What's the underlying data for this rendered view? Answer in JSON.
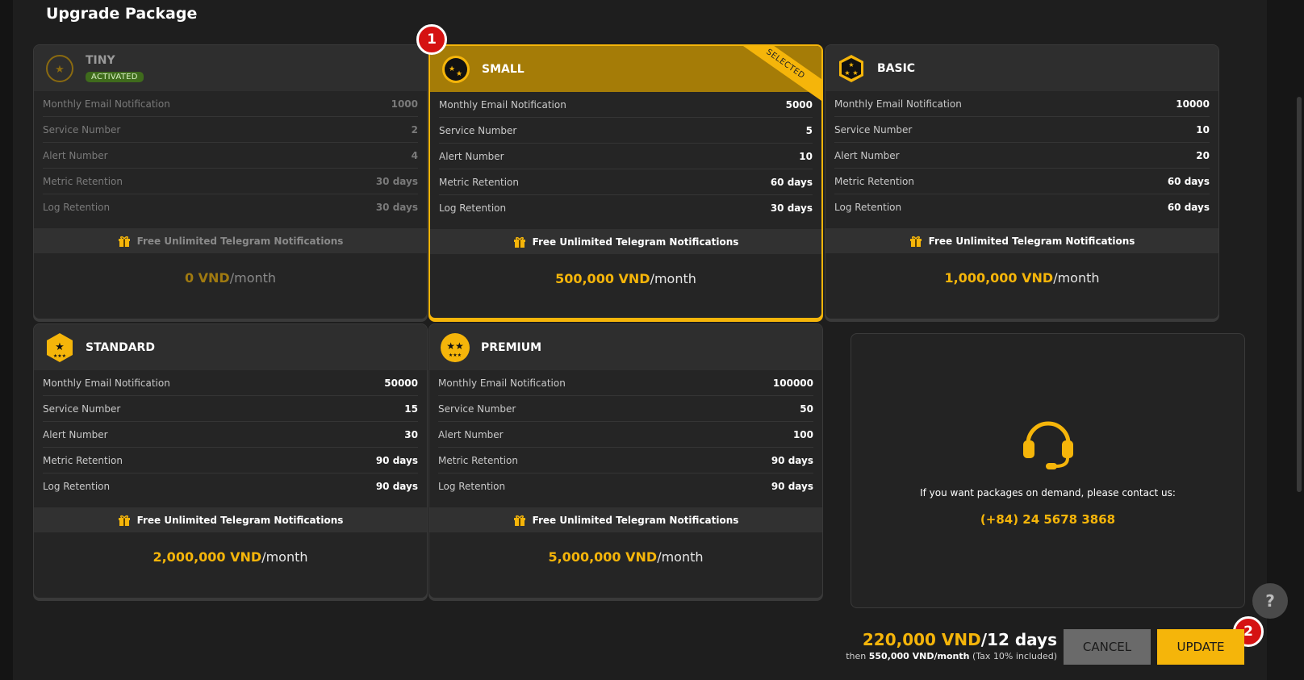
{
  "page": {
    "title": "Upgrade Package"
  },
  "colors": {
    "accent": "#f5b50a",
    "activated_bg": "#3f6b1c",
    "badge": "#d51212"
  },
  "plans": [
    {
      "name": "TINY",
      "status": "ACTIVATED",
      "rows": [
        [
          "Monthly Email Notification",
          "1000"
        ],
        [
          "Service Number",
          "2"
        ],
        [
          "Alert Number",
          "4"
        ],
        [
          "Metric Retention",
          "30 days"
        ],
        [
          "Log Retention",
          "30 days"
        ]
      ],
      "telegram": "Free Unlimited Telegram Notifications",
      "price": "0 VND",
      "per": "/month"
    },
    {
      "name": "SMALL",
      "ribbon": "SELECTED",
      "rows": [
        [
          "Monthly Email Notification",
          "5000"
        ],
        [
          "Service Number",
          "5"
        ],
        [
          "Alert Number",
          "10"
        ],
        [
          "Metric Retention",
          "60 days"
        ],
        [
          "Log Retention",
          "30 days"
        ]
      ],
      "telegram": "Free Unlimited Telegram Notifications",
      "price": "500,000 VND",
      "per": "/month"
    },
    {
      "name": "BASIC",
      "rows": [
        [
          "Monthly Email Notification",
          "10000"
        ],
        [
          "Service Number",
          "10"
        ],
        [
          "Alert Number",
          "20"
        ],
        [
          "Metric Retention",
          "60 days"
        ],
        [
          "Log Retention",
          "60 days"
        ]
      ],
      "telegram": "Free Unlimited Telegram Notifications",
      "price": "1,000,000 VND",
      "per": "/month"
    },
    {
      "name": "STANDARD",
      "rows": [
        [
          "Monthly Email Notification",
          "50000"
        ],
        [
          "Service Number",
          "15"
        ],
        [
          "Alert Number",
          "30"
        ],
        [
          "Metric Retention",
          "90 days"
        ],
        [
          "Log Retention",
          "90 days"
        ]
      ],
      "telegram": "Free Unlimited Telegram Notifications",
      "price": "2,000,000 VND",
      "per": "/month"
    },
    {
      "name": "PREMIUM",
      "rows": [
        [
          "Monthly Email Notification",
          "100000"
        ],
        [
          "Service Number",
          "50"
        ],
        [
          "Alert Number",
          "100"
        ],
        [
          "Metric Retention",
          "90 days"
        ],
        [
          "Log Retention",
          "90 days"
        ]
      ],
      "telegram": "Free Unlimited Telegram Notifications",
      "price": "5,000,000 VND",
      "per": "/month"
    }
  ],
  "contact": {
    "text": "If you want packages on demand, please contact us:",
    "phone": "(+84) 24 5678 3868",
    "icon": "headset-icon"
  },
  "footer": {
    "amount": "220,000 VND",
    "days": "/12 days",
    "then_prefix": "then",
    "then_price": "550,000 VND/month",
    "tax_note": "(Tax 10% included)",
    "cancel_label": "CANCEL",
    "update_label": "UPDATE"
  },
  "help": {
    "label": "?"
  },
  "badges": {
    "one": "1",
    "two": "2"
  }
}
